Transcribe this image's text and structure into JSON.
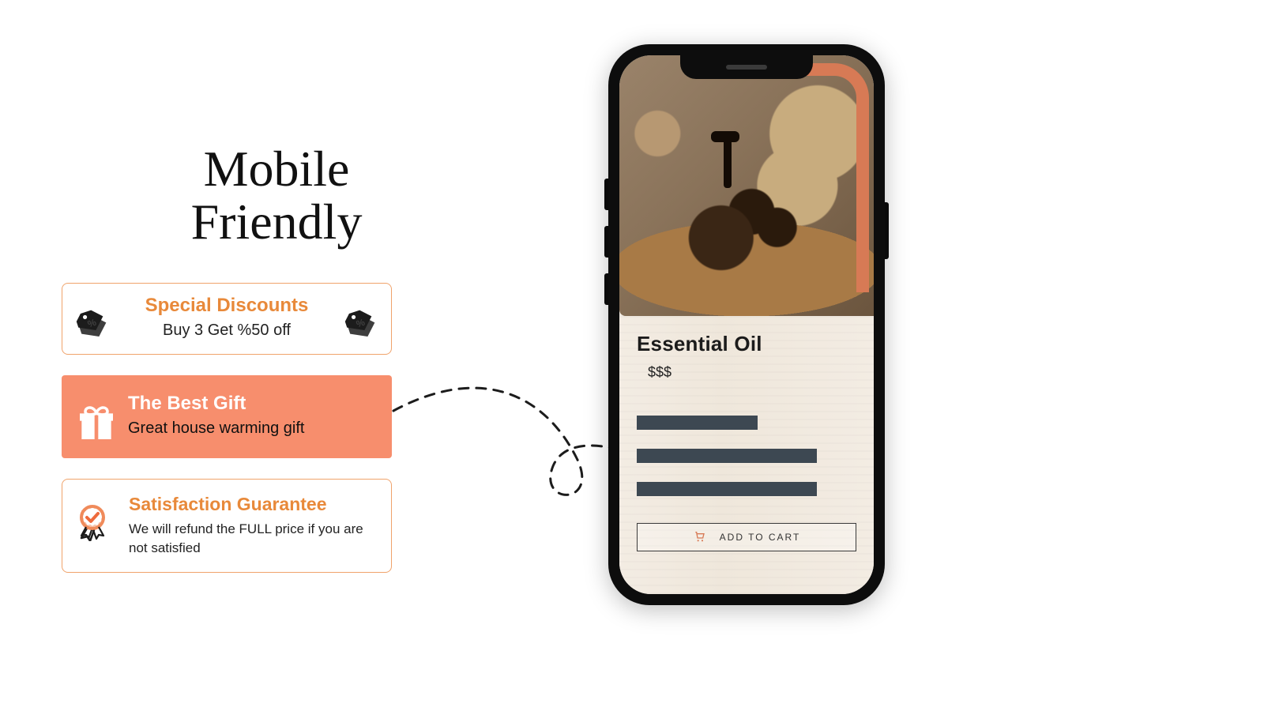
{
  "headline": "Mobile Friendly",
  "cards": {
    "discount": {
      "title": "Special Discounts",
      "sub": "Buy 3 Get %50 off"
    },
    "gift": {
      "title": "The Best Gift",
      "sub": "Great house warming  gift"
    },
    "guarantee": {
      "title": "Satisfaction Guarantee",
      "sub": "We will refund the FULL price if you are not satisfied"
    }
  },
  "phone": {
    "product_title": "Essential Oil",
    "price": "$$$",
    "cart_label": "ADD TO CART"
  },
  "colors": {
    "accent_orange": "#e8893a",
    "coral": "#f78e6d",
    "terracotta": "#d77a55",
    "slate": "#3d4852"
  }
}
